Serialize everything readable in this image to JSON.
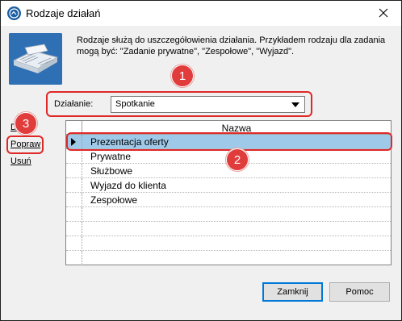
{
  "window": {
    "title": "Rodzaje działań",
    "close_glyph": "✕"
  },
  "description": {
    "line1": "Rodzaje służą do uszczegółowienia działania. Przykładem rodzaju dla zadania",
    "line2": "mogą być: \"Zadanie prywatne\", \"Zespołowe\", \"Wyjazd\"."
  },
  "filter": {
    "label": "Działanie:",
    "selected": "Spotkanie"
  },
  "side_links": {
    "add": "Dodaj",
    "edit": "Popraw",
    "delete": "Usuń"
  },
  "grid": {
    "column": "Nazwa",
    "rows": [
      "Prezentacja oferty",
      "Prywatne",
      "Służbowe",
      "Wyjazd do klienta",
      "Zespołowe"
    ],
    "selected_index": 0
  },
  "buttons": {
    "close": "Zamknij",
    "help": "Pomoc"
  },
  "annotations": {
    "badge1": "1",
    "badge2": "2",
    "badge3": "3"
  },
  "colors": {
    "highlight": "#e02828",
    "selection": "#9fc9e8",
    "app_icon": "#1d5fa3"
  },
  "icons": {
    "app": "app-logo-icon",
    "book": "book-icon",
    "close": "close-icon",
    "dropdown": "chevron-down-icon",
    "row_pointer": "row-pointer-icon"
  }
}
